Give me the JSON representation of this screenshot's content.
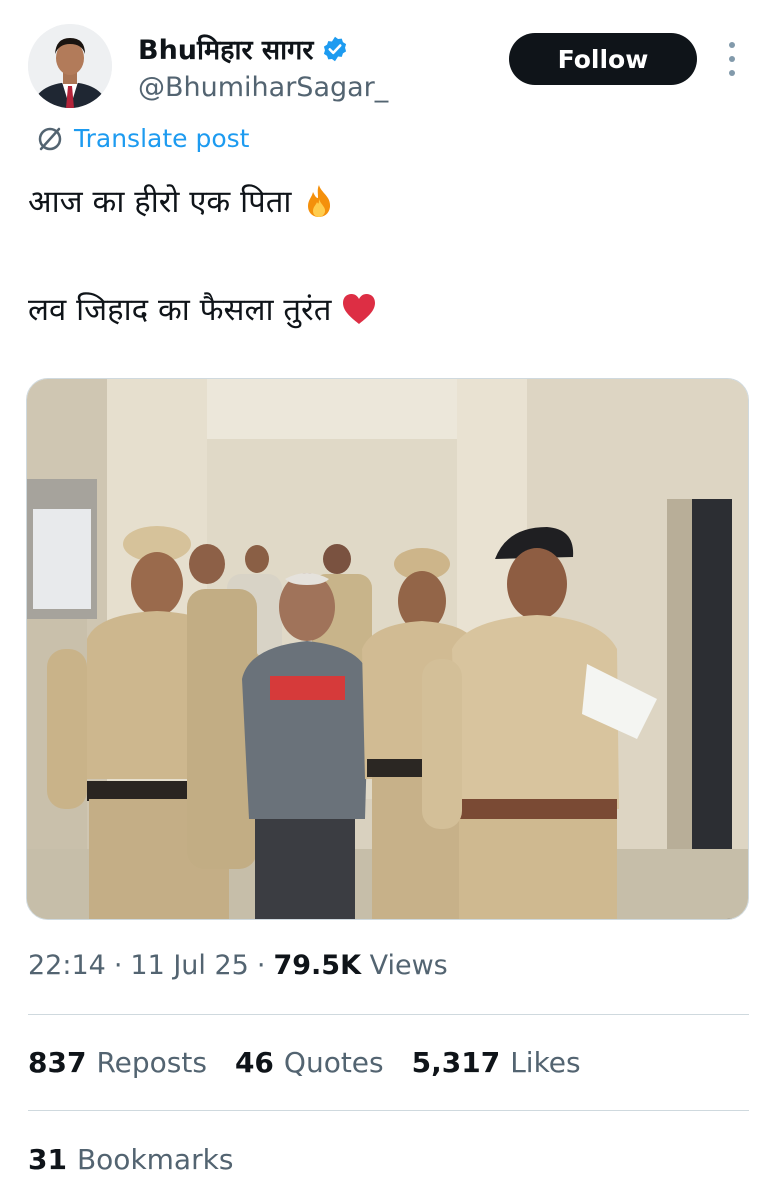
{
  "author": {
    "display_name": "Bhuमिहार सागर",
    "handle": "@BhumiharSagar_"
  },
  "follow_label": "Follow",
  "translate_label": "Translate post",
  "post": {
    "line1": "आज का हीरो एक पिता",
    "line1_emoji": "fire-icon",
    "line2": "लव जिहाद  का फैसला तुरंत",
    "line2_emoji": "red-heart-icon"
  },
  "meta": {
    "time": "22:14",
    "date": "11 Jul 25",
    "views_count": "79.5K",
    "views_label": "Views"
  },
  "stats": {
    "reposts_count": "837",
    "reposts_label": "Reposts",
    "quotes_count": "46",
    "quotes_label": "Quotes",
    "likes_count": "5,317",
    "likes_label": "Likes",
    "bookmarks_count": "31",
    "bookmarks_label": "Bookmarks"
  },
  "colors": {
    "accent": "#1d9bf0",
    "text": "#0f1419",
    "secondary": "#536471"
  }
}
